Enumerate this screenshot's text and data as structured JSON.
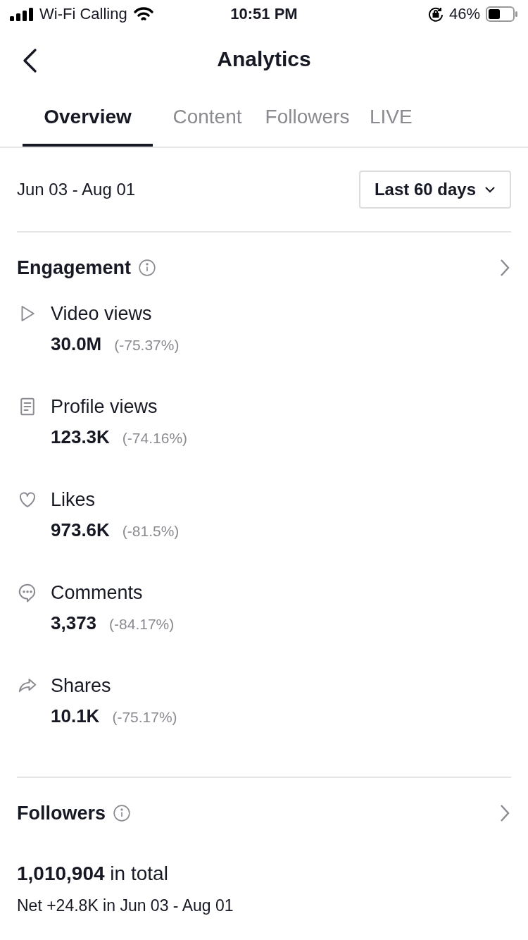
{
  "status_bar": {
    "carrier": "Wi-Fi Calling",
    "time": "10:51 PM",
    "battery": "46%"
  },
  "header": {
    "title": "Analytics"
  },
  "tabs": [
    {
      "label": "Overview",
      "selected": true
    },
    {
      "label": "Content",
      "selected": false
    },
    {
      "label": "Followers",
      "selected": false
    },
    {
      "label": "LIVE",
      "selected": false
    }
  ],
  "date_range": {
    "range": "Jun 03 - Aug 01",
    "dropdown": "Last 60 days"
  },
  "engagement": {
    "title": "Engagement",
    "metrics": [
      {
        "kind": "play",
        "label": "Video views",
        "value": "30.0M",
        "change": "(-75.37%)"
      },
      {
        "kind": "profile",
        "label": "Profile views",
        "value": "123.3K",
        "change": "(-74.16%)"
      },
      {
        "kind": "heart",
        "label": "Likes",
        "value": "973.6K",
        "change": "(-81.5%)"
      },
      {
        "kind": "comment",
        "label": "Comments",
        "value": "3,373",
        "change": "(-84.17%)"
      },
      {
        "kind": "share",
        "label": "Shares",
        "value": "10.1K",
        "change": "(-75.17%)"
      }
    ]
  },
  "followers": {
    "title": "Followers",
    "total": "**1,010,904** in total",
    "net": "Net +24.8K in Jun 03 - Aug 01"
  }
}
